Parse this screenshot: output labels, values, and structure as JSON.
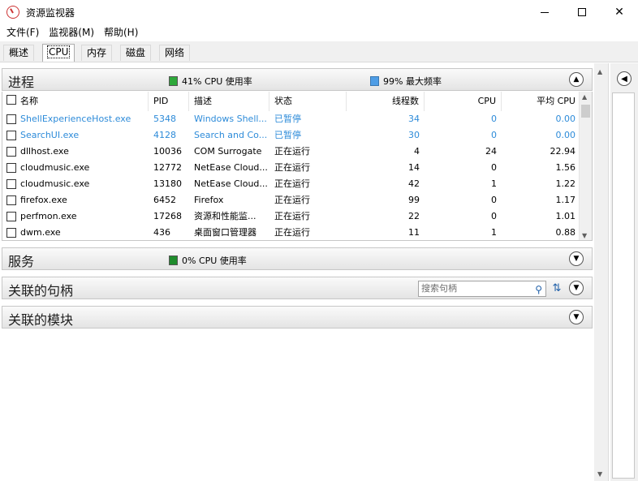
{
  "window": {
    "title": "资源监视器"
  },
  "menu": [
    "文件(F)",
    "监视器(M)",
    "帮助(H)"
  ],
  "tabs": [
    "概述",
    "CPU",
    "内存",
    "磁盘",
    "网络"
  ],
  "active_tab": "CPU",
  "processes": {
    "title": "进程",
    "cpu_usage": "41% CPU 使用率",
    "max_freq": "99% 最大频率",
    "columns": {
      "name": "名称",
      "pid": "PID",
      "desc": "描述",
      "status": "状态",
      "threads": "线程数",
      "cpu": "CPU",
      "avgcpu": "平均 CPU"
    },
    "rows": [
      {
        "name": "ShellExperienceHost.exe",
        "pid": "5348",
        "desc": "Windows Shell...",
        "status": "已暂停",
        "threads": "34",
        "cpu": "0",
        "avg": "0.00",
        "suspended": true
      },
      {
        "name": "SearchUI.exe",
        "pid": "4128",
        "desc": "Search and Co...",
        "status": "已暂停",
        "threads": "30",
        "cpu": "0",
        "avg": "0.00",
        "suspended": true
      },
      {
        "name": "dllhost.exe",
        "pid": "10036",
        "desc": "COM Surrogate",
        "status": "正在运行",
        "threads": "4",
        "cpu": "24",
        "avg": "22.94",
        "suspended": false
      },
      {
        "name": "cloudmusic.exe",
        "pid": "12772",
        "desc": "NetEase Cloud...",
        "status": "正在运行",
        "threads": "14",
        "cpu": "0",
        "avg": "1.56",
        "suspended": false
      },
      {
        "name": "cloudmusic.exe",
        "pid": "13180",
        "desc": "NetEase Cloud...",
        "status": "正在运行",
        "threads": "42",
        "cpu": "1",
        "avg": "1.22",
        "suspended": false
      },
      {
        "name": "firefox.exe",
        "pid": "6452",
        "desc": "Firefox",
        "status": "正在运行",
        "threads": "99",
        "cpu": "0",
        "avg": "1.17",
        "suspended": false
      },
      {
        "name": "perfmon.exe",
        "pid": "17268",
        "desc": "资源和性能监...",
        "status": "正在运行",
        "threads": "22",
        "cpu": "0",
        "avg": "1.01",
        "suspended": false
      },
      {
        "name": "dwm.exe",
        "pid": "436",
        "desc": "桌面窗口管理器",
        "status": "正在运行",
        "threads": "11",
        "cpu": "1",
        "avg": "0.88",
        "suspended": false
      }
    ]
  },
  "services": {
    "title": "服务",
    "cpu_usage": "0% CPU 使用率"
  },
  "handles": {
    "title": "关联的句柄",
    "search_placeholder": "搜索句柄"
  },
  "modules": {
    "title": "关联的模块"
  },
  "colors": {
    "suspended_text": "#2d8bd9",
    "cpu_green": "#2ea83a",
    "freq_blue": "#4e9de6"
  }
}
